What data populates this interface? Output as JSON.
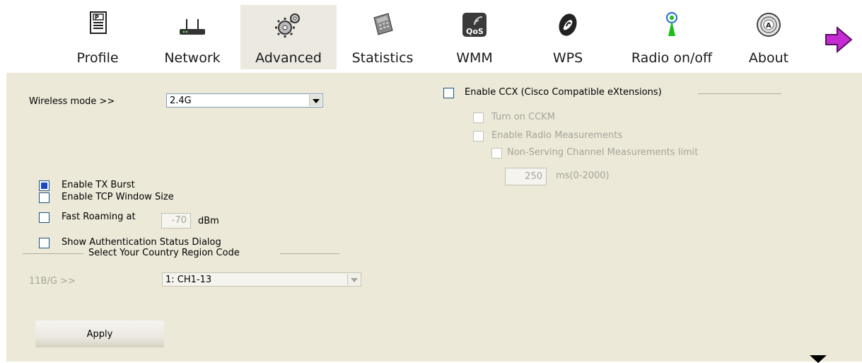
{
  "tabs": [
    {
      "label": "Profile",
      "icon": "profile-icon"
    },
    {
      "label": "Network",
      "icon": "network-router-icon"
    },
    {
      "label": "Advanced",
      "icon": "advanced-gears-icon"
    },
    {
      "label": "Statistics",
      "icon": "statistics-calculator-icon"
    },
    {
      "label": "WMM",
      "icon": "wmm-qos-icon"
    },
    {
      "label": "WPS",
      "icon": "wps-icon"
    },
    {
      "label": "Radio on/off",
      "icon": "radio-antenna-icon"
    },
    {
      "label": "About",
      "icon": "about-icon"
    }
  ],
  "active_tab": "Advanced",
  "wireless_mode": {
    "label": "Wireless mode >>",
    "value": "2.4G"
  },
  "options": {
    "tx_burst": {
      "label": "Enable TX Burst",
      "checked": true
    },
    "tcp_window": {
      "label": "Enable TCP Window Size",
      "checked": false
    },
    "fast_roaming": {
      "label": "Fast Roaming at",
      "value": "-70",
      "unit": "dBm",
      "checked": false
    },
    "auth_dialog": {
      "label": "Show Authentication Status Dialog",
      "checked": false
    }
  },
  "country": {
    "group_title": "Select Your Country Region Code",
    "label": "11B/G >>",
    "value": "1: CH1-13"
  },
  "ccx": {
    "label": "Enable CCX (Cisco Compatible eXtensions)",
    "checked": false,
    "cckm": "Turn on CCKM",
    "radio_measurements": "Enable Radio Measurements",
    "non_serving": "Non-Serving Channel Measurements limit",
    "limit_value": "250",
    "limit_unit": "ms(0-2000)"
  },
  "apply_label": "Apply",
  "colors": {
    "panel": "#ece9d8",
    "active_tab": "#ece9e1",
    "checkbox_fill": "#1947c9"
  }
}
